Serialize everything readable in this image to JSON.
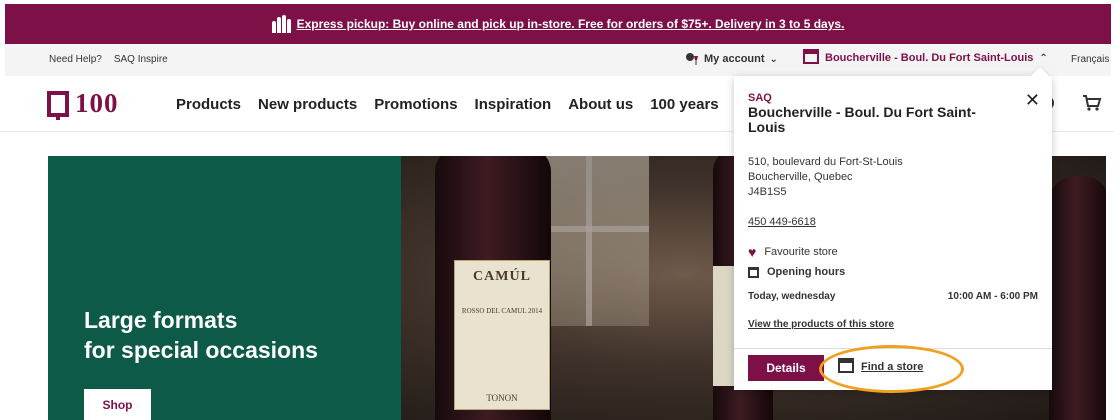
{
  "promo": {
    "text": "Express pickup: Buy online and pick up in-store. Free for orders of $75+. Delivery in 3 to 5 days.",
    "icon": "bottles-icon"
  },
  "utility": {
    "help": "Need Help?",
    "inspire": "SAQ Inspire",
    "account": "My account",
    "store": "Boucherville - Boul. Du Fort Saint-Louis",
    "language": "Français"
  },
  "nav": {
    "logo_text": "100",
    "items": [
      "Products",
      "New products",
      "Promotions",
      "Inspiration",
      "About us",
      "100 years"
    ]
  },
  "hero": {
    "title_line1": "Large formats",
    "title_line2": "for special occasions",
    "button": "Shop",
    "bottle_label": {
      "brand": "CAMÚL",
      "sub": "ROSSO DEL CAMUL 2014",
      "bottom": "TONON"
    }
  },
  "store_popup": {
    "brand": "SAQ",
    "name": "Boucherville - Boul. Du Fort Saint-Louis",
    "address_line1": "510, boulevard du Fort-St-Louis",
    "address_line2": "Boucherville, Quebec",
    "postal_code": "J4B1S5",
    "phone": "450 449-6618",
    "favourite": "Favourite store",
    "hours_label": "Opening hours",
    "today": "Today, wednesday",
    "hours": "10:00 AM - 6:00 PM",
    "view_products": "View the products of this store",
    "details_button": "Details",
    "find_store": "Find a store"
  },
  "colors": {
    "brand": "#7e1048",
    "hero_green": "#0c5a47",
    "highlight": "#f0a020"
  }
}
